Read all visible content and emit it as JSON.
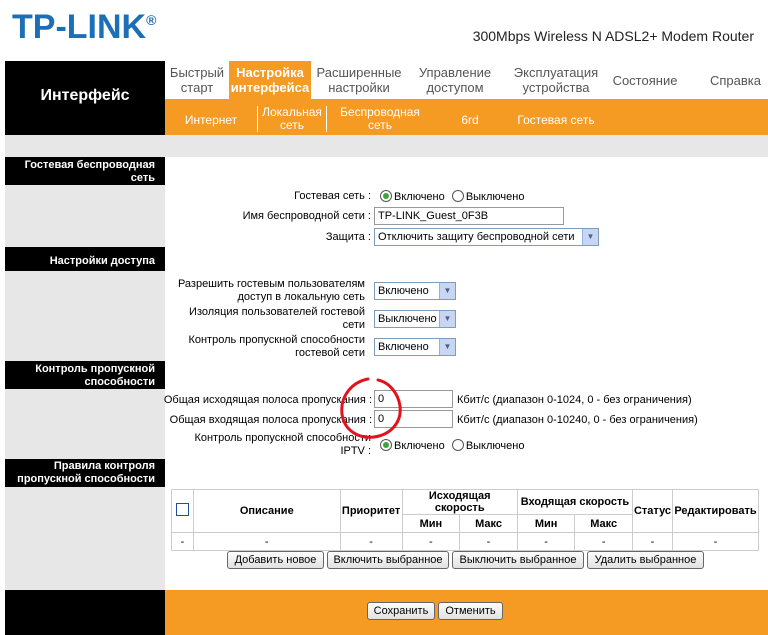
{
  "header": {
    "logo": "TP-LINK",
    "logo_mark": "®",
    "model": "300Mbps Wireless N ADSL2+ Modem Router"
  },
  "sidebar_title": "Интерфейс",
  "nav": [
    {
      "label": "Быстрый старт"
    },
    {
      "label": "Настройка интерфейса",
      "active": true
    },
    {
      "label": "Расширенные настройки"
    },
    {
      "label": "Управление доступом"
    },
    {
      "label": "Эксплуатация устройства"
    },
    {
      "label": "Состояние"
    },
    {
      "label": "Справка"
    }
  ],
  "subnav": [
    "Интернет",
    "Локальная сеть",
    "Беспроводная сеть",
    "6rd",
    "Гостевая сеть"
  ],
  "guest": {
    "section": "Гостевая беспроводная сеть",
    "network_label": "Гостевая сеть :",
    "on": "Включено",
    "off": "Выключено",
    "ssid_label": "Имя беспроводной сети :",
    "ssid_value": "TP-LINK_Guest_0F3B",
    "security_label": "Защита :",
    "security_value": "Отключить защиту беспроводной сети"
  },
  "access": {
    "section": "Настройки доступа",
    "allow_label": "Разрешить гостевым пользователям доступ в локальную сеть",
    "allow_value": "Включено",
    "isolation_label": "Изоляция пользователей гостевой сети",
    "isolation_value": "Выключено",
    "bw_label": "Контроль пропускной способности гостевой сети",
    "bw_value": "Включено"
  },
  "bandwidth": {
    "section": "Контроль пропускной способности",
    "up_label": "Общая исходящая полоса пропускания :",
    "up_value": "0",
    "up_hint": "Кбит/с (диапазон 0-1024, 0 - без ограничения)",
    "down_label": "Общая входящая полоса пропускания :",
    "down_value": "0",
    "down_hint": "Кбит/с (диапазон 0-10240, 0 - без ограничения)",
    "iptv_label": "Контроль пропускной способности IPTV :",
    "on": "Включено",
    "off": "Выключено"
  },
  "rules": {
    "section": "Правила контроля пропускной способности",
    "col_desc": "Описание",
    "col_priority": "Приоритет",
    "col_up": "Исходящая скорость",
    "col_down": "Входящая скорость",
    "col_min": "Мин",
    "col_max": "Макс",
    "col_status": "Статус",
    "col_edit": "Редактировать",
    "row": [
      "-",
      "-",
      "-",
      "-",
      "-",
      "-",
      "-",
      "-",
      "-"
    ],
    "btn_add": "Добавить новое",
    "btn_enable": "Включить выбранное",
    "btn_disable": "Выключить выбранное",
    "btn_delete": "Удалить выбранное"
  },
  "footer": {
    "save": "Сохранить",
    "cancel": "Отменить"
  },
  "colors": {
    "accent": "#f59a23",
    "logo": "#1c6fb6",
    "annotation": "#e0141e"
  }
}
